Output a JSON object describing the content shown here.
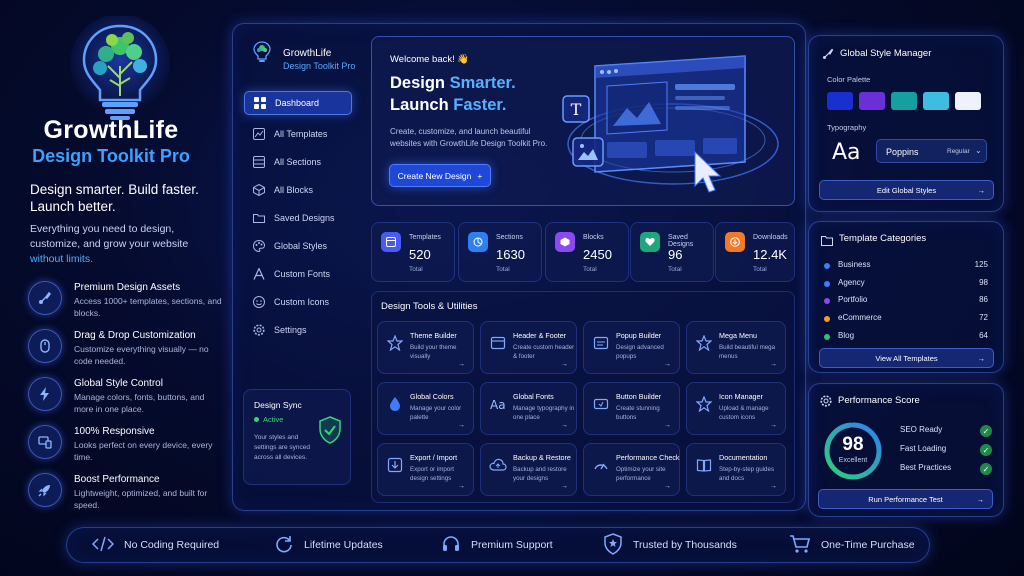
{
  "brand": {
    "name": "GrowthLife",
    "product": "Design Toolkit Pro",
    "tagline": "Design smarter. Build faster. Launch better.",
    "lead": "Everything you need to design, customize, and grow your website",
    "lead_highlight": "without limits."
  },
  "features": [
    {
      "icon": "brush-icon",
      "title": "Premium Design Assets",
      "desc": "Access 1000+ templates, sections, and blocks."
    },
    {
      "icon": "mouse-icon",
      "title": "Drag & Drop Customization",
      "desc": "Customize everything visually — no code needed."
    },
    {
      "icon": "bolt-icon",
      "title": "Global Style Control",
      "desc": "Manage colors, fonts, buttons, and more in one place."
    },
    {
      "icon": "responsive-icon",
      "title": "100% Responsive",
      "desc": "Looks perfect on every device, every time."
    },
    {
      "icon": "rocket-icon",
      "title": "Boost Performance",
      "desc": "Lightweight, optimized, and built for speed."
    }
  ],
  "sidebar": {
    "brand": "GrowthLife",
    "sub": "Design Toolkit Pro",
    "items": [
      {
        "label": "Dashboard",
        "icon": "grid-icon"
      },
      {
        "label": "All Templates",
        "icon": "template-icon"
      },
      {
        "label": "All Sections",
        "icon": "sections-icon"
      },
      {
        "label": "All Blocks",
        "icon": "blocks-icon"
      },
      {
        "label": "Saved Designs",
        "icon": "folder-icon"
      },
      {
        "label": "Global Styles",
        "icon": "palette-icon"
      },
      {
        "label": "Custom Fonts",
        "icon": "font-icon"
      },
      {
        "label": "Custom Icons",
        "icon": "smile-icon"
      },
      {
        "label": "Settings",
        "icon": "gear-icon"
      }
    ],
    "sync": {
      "title": "Design Sync",
      "status": "Active",
      "desc": "Your styles and settings are synced across all devices."
    }
  },
  "hero": {
    "welcome": "Welcome back! 👋",
    "line1_a": "Design ",
    "line1_b": "Smarter.",
    "line2_a": "Launch ",
    "line2_b": "Faster.",
    "desc": "Create, customize, and launch beautiful websites with GrowthLife Design Toolkit Pro.",
    "button": "Create New Design",
    "button_icon": "+"
  },
  "stats": [
    {
      "label": "Templates",
      "value": "520",
      "sub": "Total",
      "color": "#4a5cf0",
      "icon": "template-icon"
    },
    {
      "label": "Sections",
      "value": "1630",
      "sub": "Total",
      "color": "#2f7ff0",
      "icon": "sections-icon"
    },
    {
      "label": "Blocks",
      "value": "2450",
      "sub": "Total",
      "color": "#8a4af0",
      "icon": "blocks-icon"
    },
    {
      "label": "Saved Designs",
      "value": "96",
      "sub": "Total",
      "color": "#1fa67a",
      "icon": "heart-icon"
    },
    {
      "label": "Downloads",
      "value": "12.4K",
      "sub": "Total",
      "color": "#f07a2a",
      "icon": "download-icon"
    }
  ],
  "tools": {
    "title": "Design Tools & Utilities",
    "items": [
      {
        "title": "Theme Builder",
        "desc": "Build your theme visually",
        "icon": "star-icon"
      },
      {
        "title": "Header & Footer",
        "desc": "Create custom header & footer",
        "icon": "layout-icon"
      },
      {
        "title": "Popup Builder",
        "desc": "Design advanced popups",
        "icon": "popup-icon"
      },
      {
        "title": "Mega Menu",
        "desc": "Build beautiful mega menus",
        "icon": "menu-icon"
      },
      {
        "title": "Global Colors",
        "desc": "Manage your color palette",
        "icon": "drop-icon"
      },
      {
        "title": "Global Fonts",
        "desc": "Manage typography in one place",
        "icon": "font-icon"
      },
      {
        "title": "Button Builder",
        "desc": "Create stunning buttons",
        "icon": "button-icon"
      },
      {
        "title": "Icon Manager",
        "desc": "Upload & manage custom icons",
        "icon": "star-outline-icon"
      },
      {
        "title": "Export / Import",
        "desc": "Export or import design settings",
        "icon": "export-icon"
      },
      {
        "title": "Backup & Restore",
        "desc": "Backup and restore your designs",
        "icon": "cloud-icon"
      },
      {
        "title": "Performance Check",
        "desc": "Optimize your site performance",
        "icon": "gauge-icon"
      },
      {
        "title": "Documentation",
        "desc": "Step-by-step guides and docs",
        "icon": "book-icon"
      }
    ],
    "arrow": "→"
  },
  "style_manager": {
    "title": "Global Style Manager",
    "palette_label": "Color Palette",
    "palette": [
      "#1a2fd0",
      "#6a2fd6",
      "#14a0a0",
      "#3fbde0",
      "#eef2ff"
    ],
    "typography_label": "Typography",
    "sample": "Aa",
    "font": "Poppins",
    "weight": "Regular",
    "button": "Edit Global Styles"
  },
  "categories": {
    "title": "Template Categories",
    "items": [
      {
        "name": "Business",
        "count": "125",
        "color": "#3d7bff"
      },
      {
        "name": "Agency",
        "count": "98",
        "color": "#3d7bff"
      },
      {
        "name": "Portfolio",
        "count": "86",
        "color": "#8a4af0"
      },
      {
        "name": "eCommerce",
        "count": "72",
        "color": "#f0a020"
      },
      {
        "name": "Blog",
        "count": "64",
        "color": "#2fc07a"
      }
    ],
    "button": "View All Templates"
  },
  "performance": {
    "title": "Performance Score",
    "score": "98",
    "score_value": 98,
    "score_label": "Excellent",
    "checks": [
      "SEO Ready",
      "Fast Loading",
      "Best Practices"
    ],
    "button": "Run Performance Test"
  },
  "bottom_bar": [
    {
      "label": "No Coding Required",
      "icon": "code-icon"
    },
    {
      "label": "Lifetime Updates",
      "icon": "refresh-icon"
    },
    {
      "label": "Premium Support",
      "icon": "headset-icon"
    },
    {
      "label": "Trusted by Thousands",
      "icon": "shield-star-icon"
    },
    {
      "label": "One-Time Purchase",
      "icon": "cart-icon"
    }
  ],
  "arrow": "→",
  "check": "✓"
}
